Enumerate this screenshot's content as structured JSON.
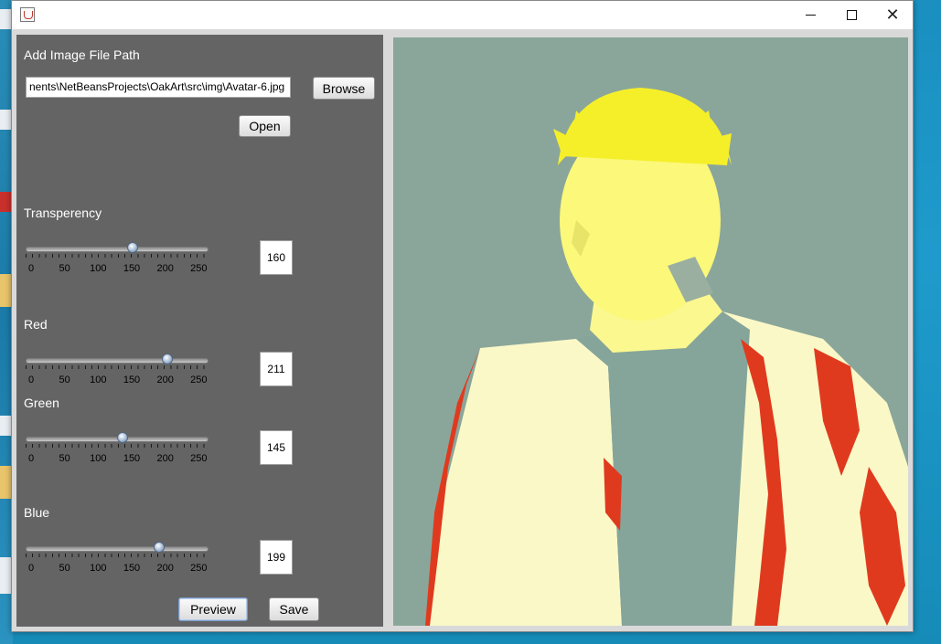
{
  "window": {
    "title": ""
  },
  "panel": {
    "file_label": "Add Image File Path",
    "file_path": "nents\\NetBeansProjects\\OakArt\\src\\img\\Avatar-6.jpg",
    "browse_label": "Browse",
    "open_label": "Open",
    "tick_labels": [
      "0",
      "50",
      "100",
      "150",
      "200",
      "250"
    ],
    "sliders": {
      "transparency": {
        "label": "Transperency",
        "value": "160",
        "level": 160
      },
      "red": {
        "label": "Red",
        "value": "211",
        "level": 211
      },
      "green": {
        "label": "Green",
        "value": "145",
        "level": 145
      },
      "blue": {
        "label": "Blue",
        "value": "199",
        "level": 199
      }
    },
    "slider_max": 270,
    "preview_label": "Preview",
    "save_label": "Save"
  },
  "colors": {
    "panel_bg": "#646464",
    "image_bg": "#8aa69a",
    "highlight_yellow": "#ffff66",
    "highlight_red": "#e03a1e"
  }
}
